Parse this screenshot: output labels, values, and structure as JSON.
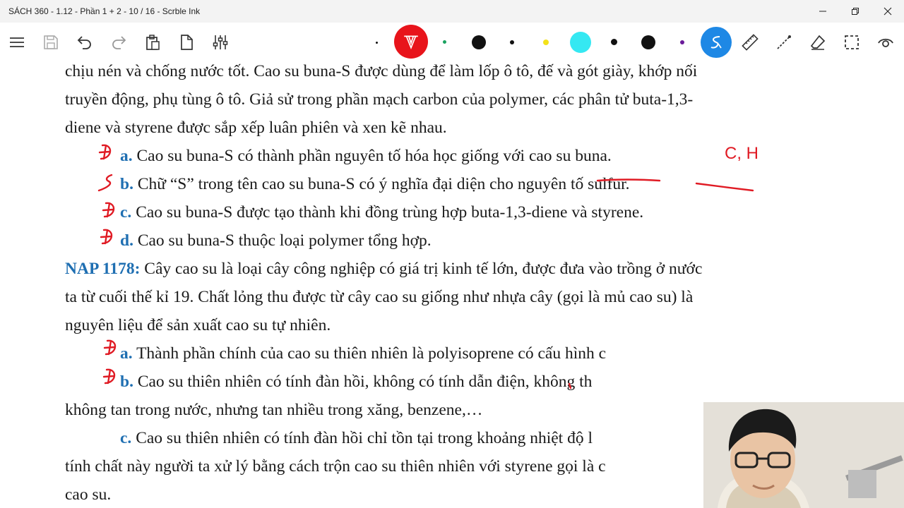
{
  "window": {
    "title": "SÁCH 360 - 1.12 - Phần 1 + 2 - 10 / 16 - Scrble Ink"
  },
  "toolbar": {
    "icons": [
      "menu-icon",
      "save-icon",
      "undo-icon",
      "redo-icon",
      "clipboard-icon",
      "page-icon",
      "sliders-icon",
      "pen-icon",
      "highlighter-icon",
      "ruler-icon",
      "line-icon",
      "eraser-icon",
      "select-icon",
      "view-icon"
    ],
    "colors": {
      "pen_active": "#e8141b",
      "green": "#1aa260",
      "black": "#111111",
      "yellow": "#f3e21a",
      "cyan": "#35e8f2",
      "purple": "#6a1b9a",
      "active_tool": "#1e88e5"
    }
  },
  "document": {
    "lines": [
      "chịu nén và chống nước tốt. Cao su buna-S được dùng để làm lốp ô tô, đế và gót giày, khớp nối",
      "truyền động, phụ tùng ô tô. Giả sử trong phần mạch carbon của polymer, các phân tử buta-1,3-",
      "diene và styrene được sắp xếp luân phiên và xen kẽ nhau."
    ],
    "q1": {
      "a": {
        "label": "a.",
        "text": "Cao su buna-S có thành phần nguyên tố hóa học giống với cao su buna."
      },
      "b": {
        "label": "b.",
        "text": "Chữ “S” trong tên cao su buna-S có ý nghĩa đại diện cho nguyên tố sulfur."
      },
      "c": {
        "label": "c.",
        "text": "Cao su buna-S được tạo thành khi đồng trùng hợp buta-1,3-diene và styrene."
      },
      "d": {
        "label": "d.",
        "text": "Cao su buna-S thuộc loại polymer tổng hợp."
      }
    },
    "nap": {
      "heading": "NAP 1178:",
      "line1": "Cây cao su là loại cây công nghiệp có giá trị kinh tế lớn, được đưa vào trồng ở nước",
      "line2": "ta từ cuối thế kỉ 19. Chất lỏng thu được từ cây cao su giống như nhựa cây (gọi là mủ cao su) là",
      "line3": "nguyên liệu để sản xuất cao su tự nhiên."
    },
    "q2": {
      "a": {
        "label": "a.",
        "text": "Thành phần chính của cao su thiên nhiên là polyisoprene có cấu hình c"
      },
      "b": {
        "label": "b.",
        "text": "Cao su thiên nhiên có tính đàn hồi, không có tính dẫn điện, không th"
      },
      "b_cont": "không tan trong nước, nhưng tan nhiều trong xăng, benzene,…",
      "c": {
        "label": "c.",
        "text": "Cao su thiên nhiên có tính đàn hồi chỉ tồn tại trong khoảng nhiệt độ l"
      },
      "c_cont1": "tính chất này người ta xử lý bằng cách trộn cao su thiên nhiên với styrene gọi là c",
      "c_cont2": "cao su."
    }
  },
  "annotations": {
    "ink_color": "#e01b24",
    "q1a_note": "C, H"
  }
}
